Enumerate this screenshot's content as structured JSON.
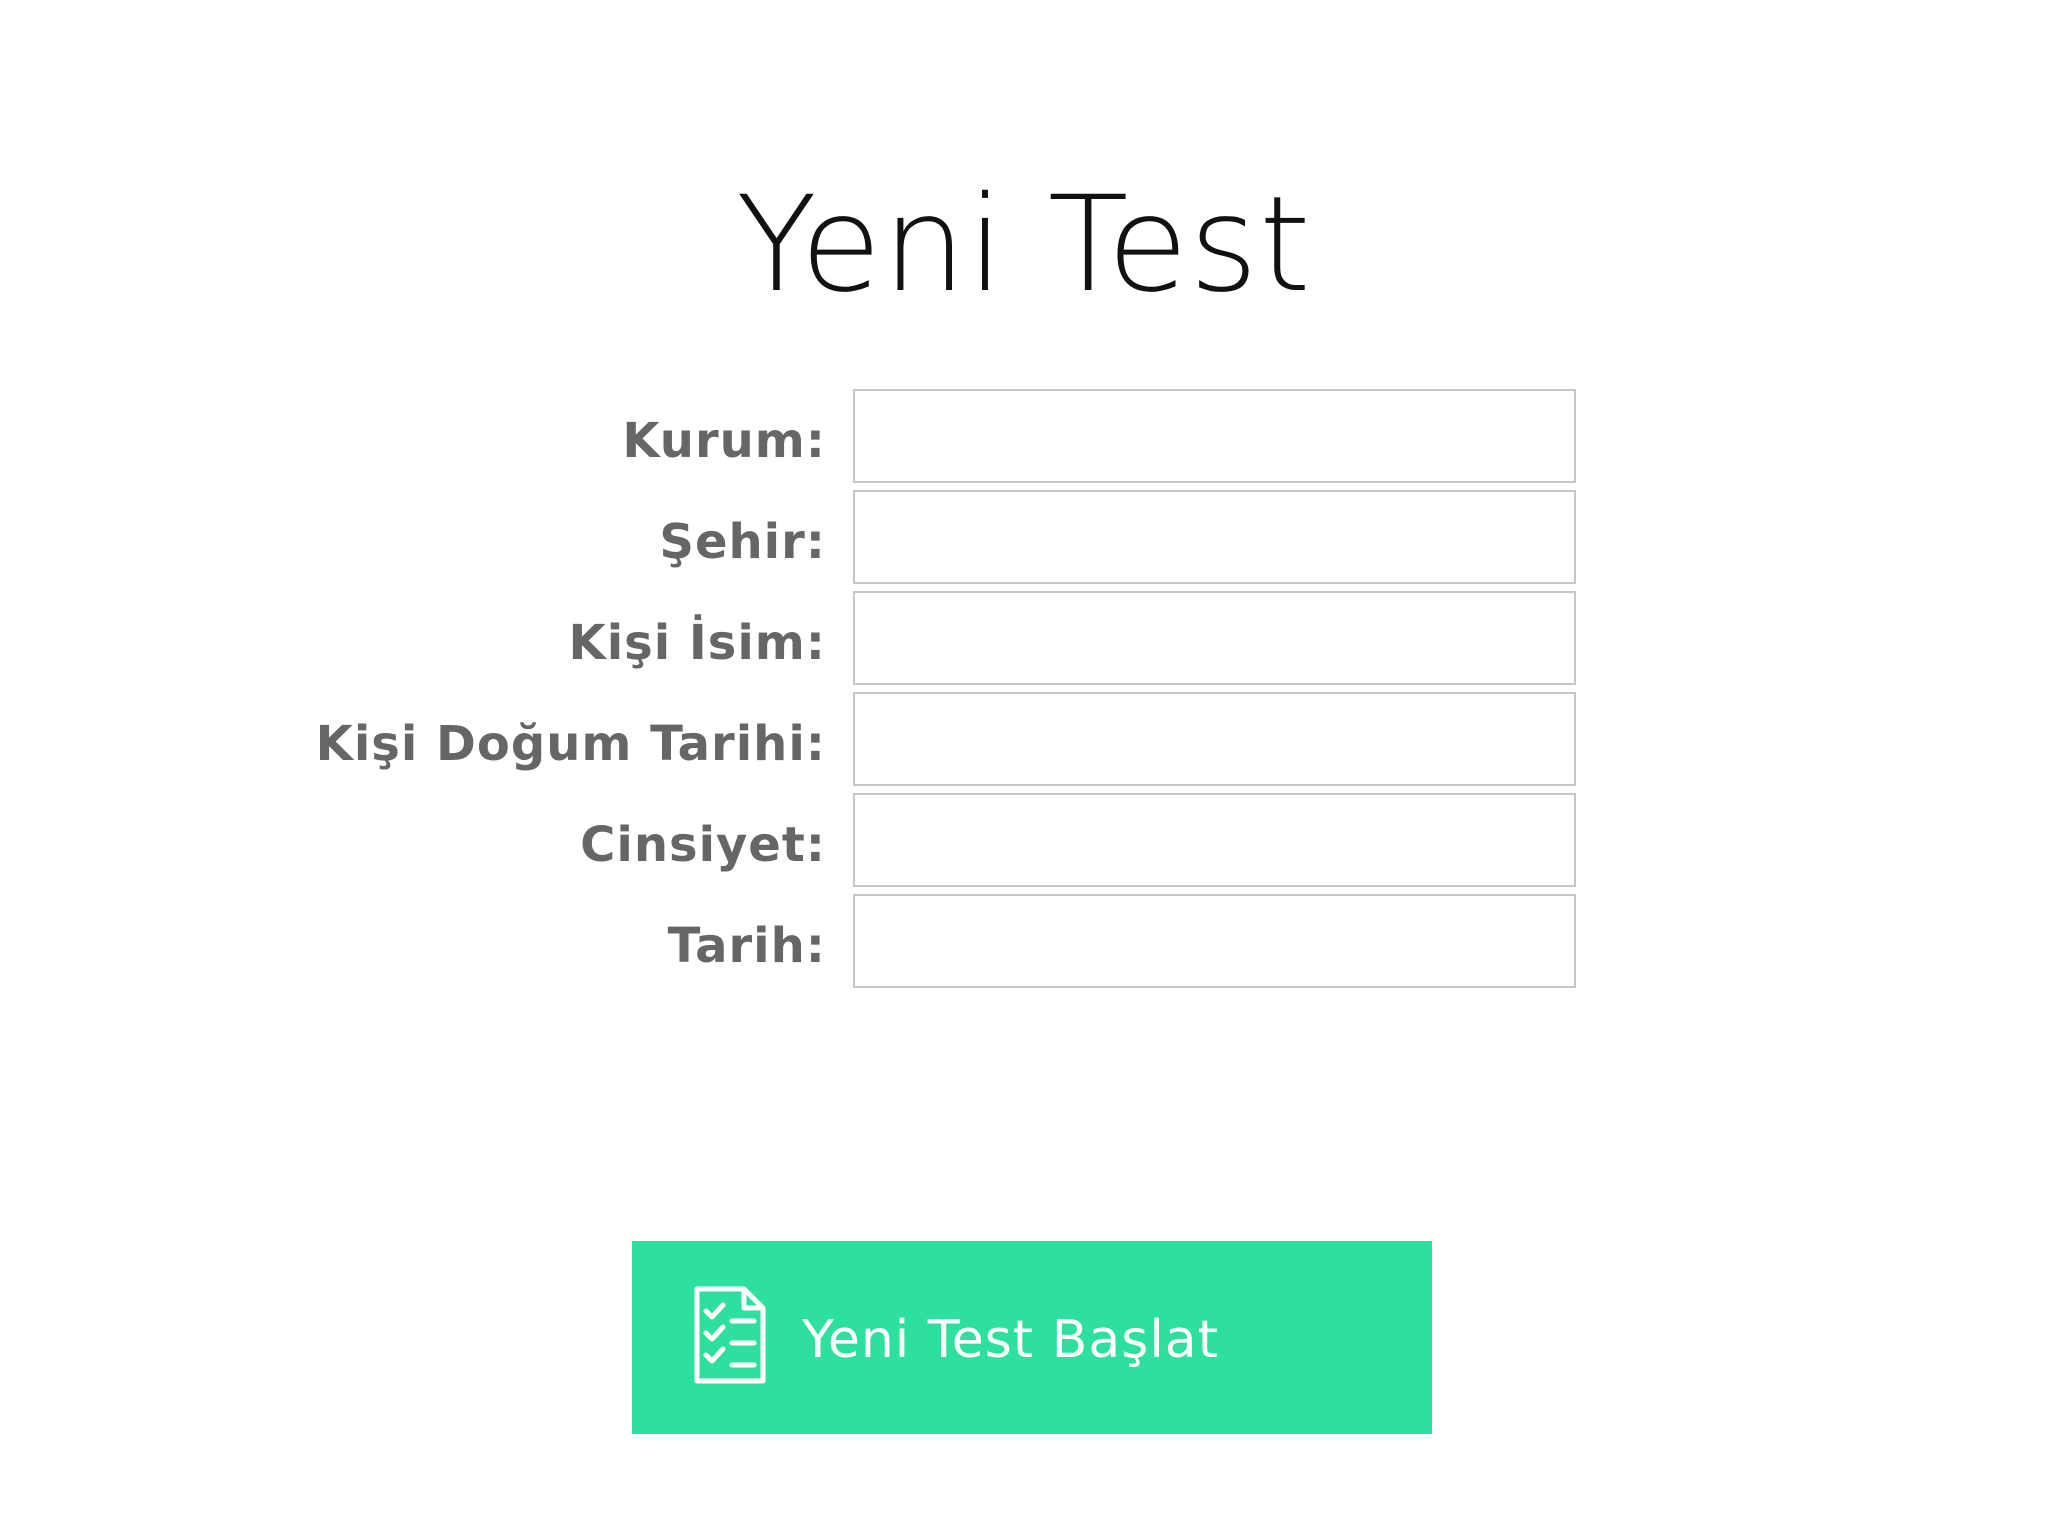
{
  "page": {
    "title": "Yeni Test"
  },
  "form": {
    "fields": [
      {
        "label": "Kurum:",
        "value": "",
        "placeholder": ""
      },
      {
        "label": "Şehir:",
        "value": "",
        "placeholder": ""
      },
      {
        "label": "Kişi İsim:",
        "value": "",
        "placeholder": ""
      },
      {
        "label": "Kişi Doğum Tarihi:",
        "value": "",
        "placeholder": ""
      },
      {
        "label": "Cinsiyet:",
        "value": "",
        "placeholder": ""
      },
      {
        "label": "Tarih:",
        "value": "",
        "placeholder": ""
      }
    ]
  },
  "start_button": {
    "label": "Yeni Test Başlat",
    "icon": "checklist-icon",
    "background_color": "#2ee09e",
    "text_color": "#ffffff"
  },
  "colors": {
    "label_text": "#666666",
    "title_text": "#111111",
    "field_border": "#c6c6c6"
  }
}
